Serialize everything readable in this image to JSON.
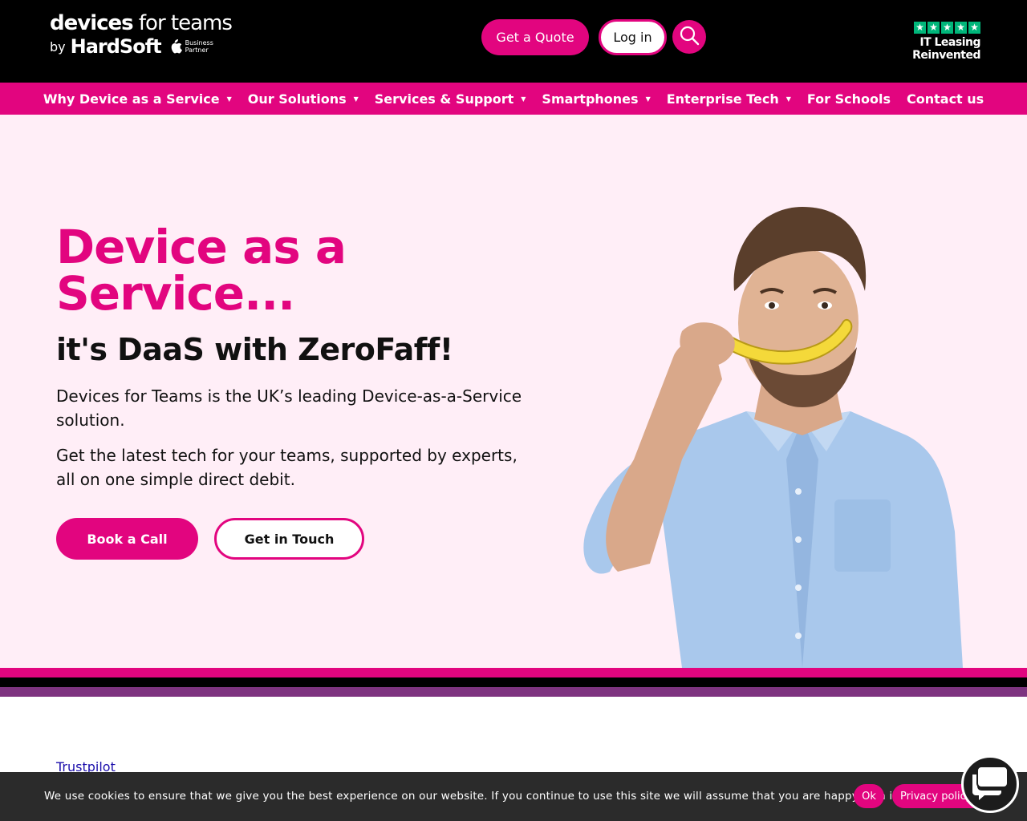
{
  "header": {
    "logo_line1_bold": "devices",
    "logo_line1_light": " for teams",
    "logo_by": "by",
    "logo_brand": "HardSoft",
    "apple_badge_line1": "Business",
    "apple_badge_line2": "Partner",
    "quote_button": "Get a Quote",
    "login_button": "Log in",
    "trustpilot_tagline": "IT Leasing Reinvented",
    "trustpilot_stars": 5
  },
  "nav": {
    "items": [
      {
        "label": "Why Device as a Service",
        "has_dropdown": true
      },
      {
        "label": "Our Solutions",
        "has_dropdown": true
      },
      {
        "label": "Services & Support",
        "has_dropdown": true
      },
      {
        "label": "Smartphones",
        "has_dropdown": true
      },
      {
        "label": "Enterprise Tech",
        "has_dropdown": true
      },
      {
        "label": "For Schools",
        "has_dropdown": false
      },
      {
        "label": "Contact us",
        "has_dropdown": false
      }
    ]
  },
  "hero": {
    "title": "Device as a Service...",
    "subtitle": "it's DaaS with ZeroFaff!",
    "paragraph1": "Devices for Teams is the UK’s leading Device-as-a-Service solution.",
    "paragraph2": "Get the latest tech for your teams, supported by experts, all on one simple direct debit.",
    "book_button": "Book a Call",
    "touch_button": "Get in Touch"
  },
  "trustpilot_link": "Trustpilot",
  "cookie": {
    "text": "We use cookies to ensure that we give you the best experience on our website. If you continue to use this site we will assume that you are happy with it.",
    "ok_button": "Ok",
    "privacy_button": "Privacy policy"
  },
  "colors": {
    "brand_pink": "#e2057f",
    "hero_bg": "#ffeef7",
    "purple_stripe": "#7e3480",
    "trustpilot_green": "#00b67a"
  },
  "icons": {
    "search": "search-icon",
    "apple": "apple-icon",
    "star": "star-icon",
    "chat": "chat-icon",
    "caret": "caret-down-icon"
  }
}
